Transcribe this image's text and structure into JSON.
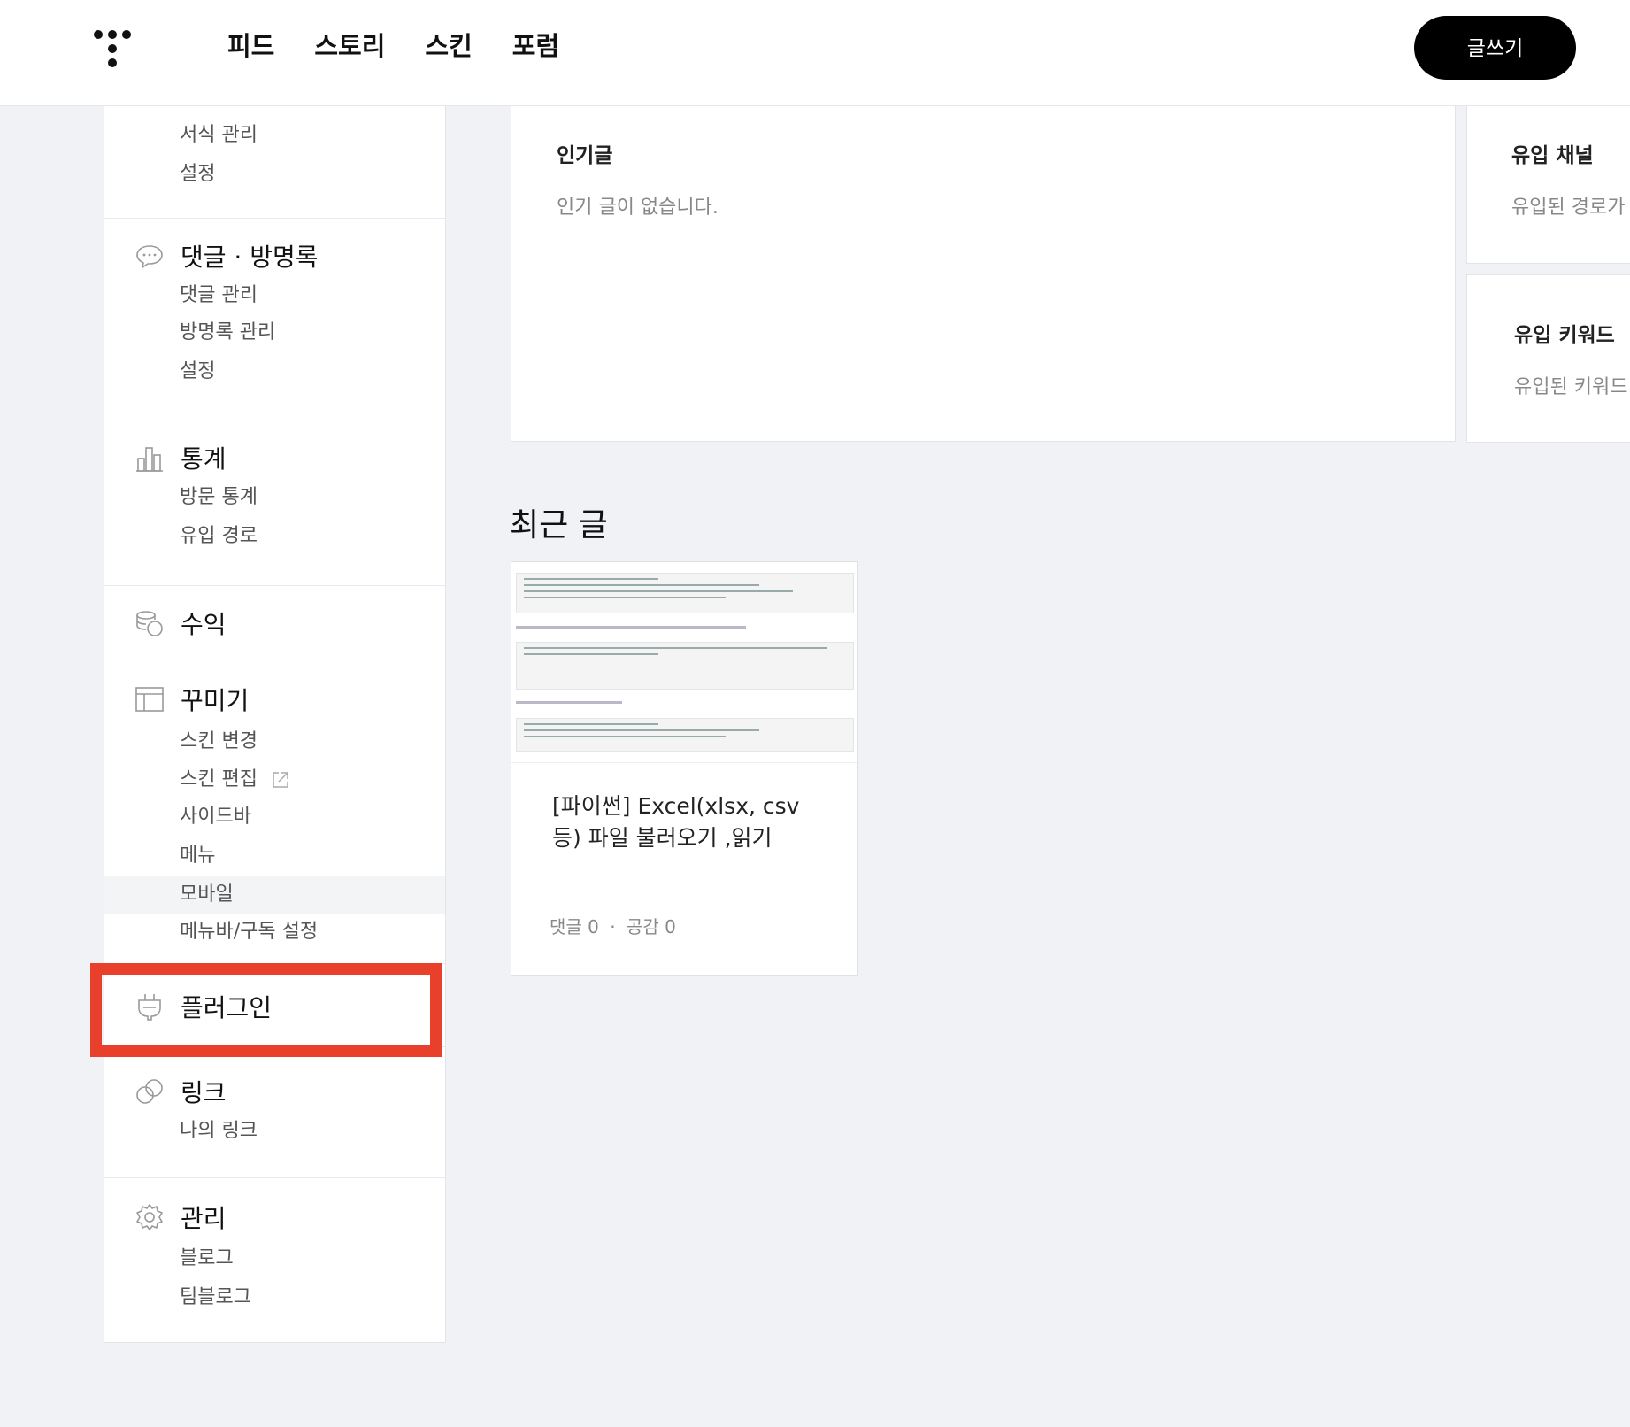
{
  "header": {
    "nav": [
      "피드",
      "스토리",
      "스킨",
      "포럼"
    ],
    "write_button": "글쓰기"
  },
  "sidebar": {
    "top_partial": {
      "items": [
        "서식 관리",
        "설정"
      ]
    },
    "comments": {
      "title": "댓글 · 방명록",
      "icon": "speech-bubble-icon",
      "items": [
        "댓글 관리",
        "방명록 관리",
        "설정"
      ]
    },
    "stats": {
      "title": "통계",
      "icon": "bar-chart-icon",
      "items": [
        "방문 통계",
        "유입 경로"
      ]
    },
    "revenue": {
      "title": "수익",
      "icon": "coins-icon"
    },
    "decorate": {
      "title": "꾸미기",
      "icon": "layout-icon",
      "items": [
        "스킨 변경",
        "스킨 편집",
        "사이드바",
        "메뉴",
        "모바일",
        "메뉴바/구독 설정"
      ],
      "active_item": "모바일"
    },
    "plugin": {
      "title": "플러그인",
      "icon": "plug-icon"
    },
    "link": {
      "title": "링크",
      "icon": "link-icon",
      "items": [
        "나의 링크"
      ]
    },
    "manage": {
      "title": "관리",
      "icon": "gear-icon",
      "items": [
        "블로그",
        "팀블로그"
      ]
    }
  },
  "main": {
    "popular": {
      "title": "인기글",
      "empty": "인기 글이 없습니다."
    },
    "inflow_channel": {
      "title": "유입 채널",
      "empty": "유입된 경로가"
    },
    "inflow_keyword": {
      "title": "유입 키워드",
      "empty": "유입된 키워드"
    },
    "recent": {
      "title": "최근 글",
      "post": {
        "title": "[파이썬] Excel(xlsx, csv 등) 파일 불러오기 ,읽기",
        "comments_label": "댓글 0",
        "likes_label": "공감 0"
      }
    }
  },
  "colors": {
    "highlight": "#e8402a",
    "accent": "#000000"
  }
}
